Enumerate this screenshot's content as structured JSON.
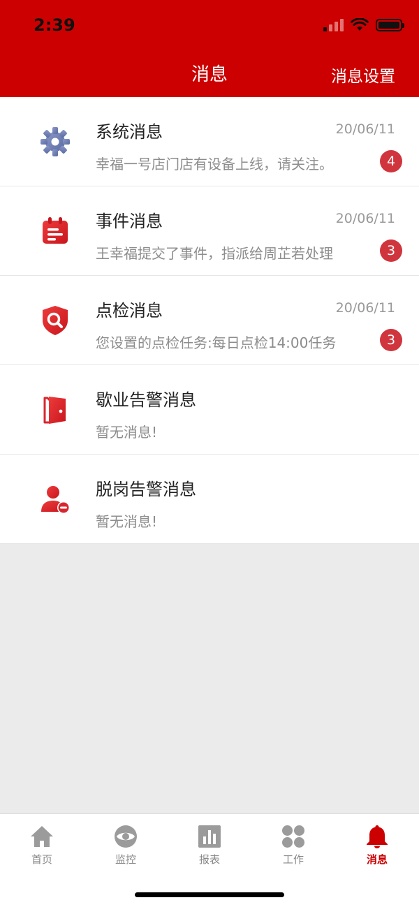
{
  "status_bar": {
    "time": "2:39"
  },
  "header": {
    "title": "消息",
    "settings_label": "消息设置"
  },
  "messages": [
    {
      "title": "系统消息",
      "date": "20/06/11",
      "preview": "幸福一号店门店有设备上线，请关注。",
      "badge": "4",
      "icon": "gear-icon"
    },
    {
      "title": "事件消息",
      "date": "20/06/11",
      "preview": "王幸福提交了事件，指派给周芷若处理",
      "badge": "3",
      "icon": "calendar-icon"
    },
    {
      "title": "点检消息",
      "date": "20/06/11",
      "preview": "您设置的点检任务:每日点检14:00任务",
      "badge": "3",
      "icon": "shield-search-icon"
    },
    {
      "title": "歇业告警消息",
      "date": "",
      "preview": "暂无消息!",
      "badge": "",
      "icon": "door-icon"
    },
    {
      "title": "脱岗告警消息",
      "date": "",
      "preview": "暂无消息!",
      "badge": "",
      "icon": "user-off-icon"
    }
  ],
  "tabbar": {
    "items": [
      {
        "label": "首页",
        "icon": "home-icon"
      },
      {
        "label": "监控",
        "icon": "eye-icon"
      },
      {
        "label": "报表",
        "icon": "chart-icon"
      },
      {
        "label": "工作",
        "icon": "grid-icon"
      },
      {
        "label": "消息",
        "icon": "bell-icon"
      }
    ],
    "active_index": 4
  },
  "colors": {
    "brand": "#cc0000",
    "badge": "#d0343c",
    "icon_red": "#d8262f",
    "icon_gear": "#6f7fb0"
  }
}
